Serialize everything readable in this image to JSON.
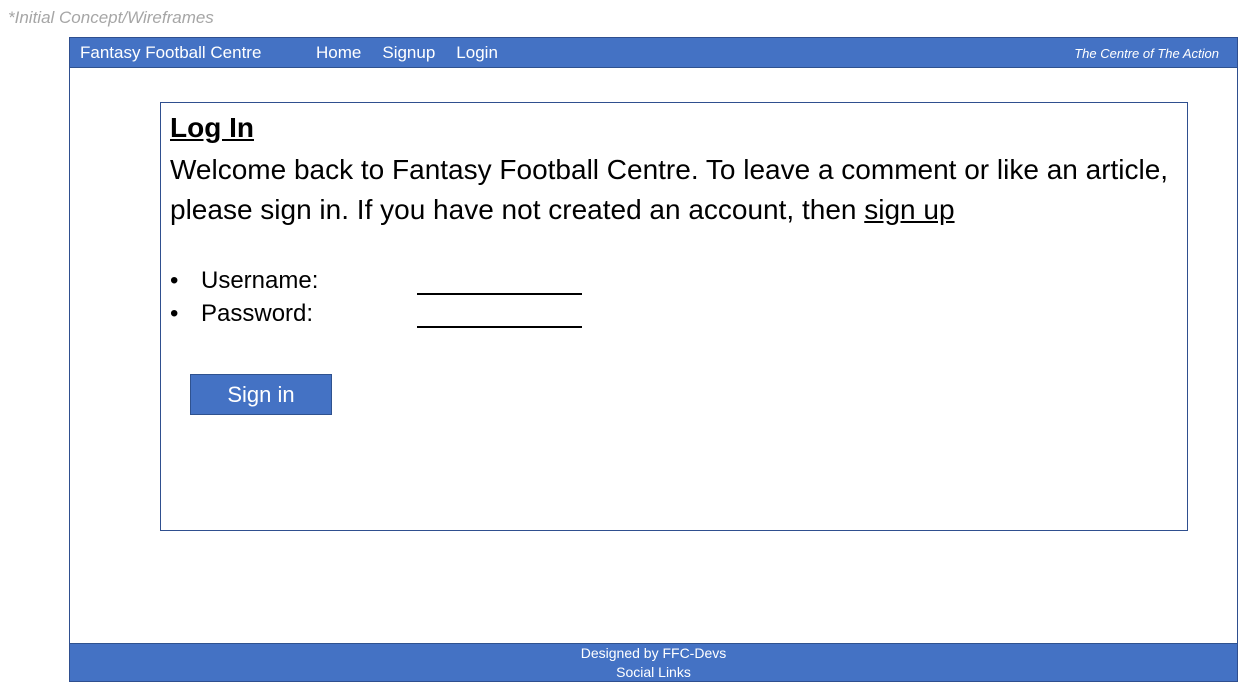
{
  "annotation": {
    "text": "*Initial Concept/Wireframes"
  },
  "navbar": {
    "brand": "Fantasy Football Centre",
    "links": [
      "Home",
      "Signup",
      "Login"
    ],
    "tagline": "The Centre of The Action"
  },
  "login": {
    "title": "Log In",
    "intro_text": "Welcome back to Fantasy Football Centre. To leave a comment or like an article, please sign in. If you have not created an account, then ",
    "signup_link": "sign up",
    "bullet": "•",
    "fields": [
      {
        "label": "Username:",
        "value": ""
      },
      {
        "label": "Password:",
        "value": ""
      }
    ],
    "submit_label": "Sign in"
  },
  "footer": {
    "credit": "Designed by FFC-Devs",
    "social_links": "Social Links"
  },
  "colors": {
    "accent": "#4472c4",
    "border": "#2f528f",
    "annotation": "#a6a6a6"
  }
}
